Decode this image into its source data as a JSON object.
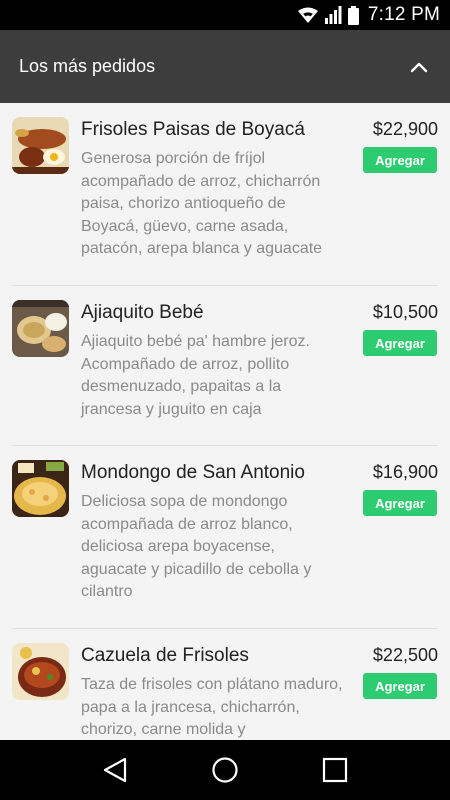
{
  "status_bar": {
    "time": "7:12 PM",
    "icons": [
      "wifi-icon",
      "signal-icon",
      "battery-icon"
    ]
  },
  "header": {
    "title": "Los más pedidos",
    "collapse_icon": "chevron-up-icon"
  },
  "items": [
    {
      "name": "Frisoles Paisas de Boyacá",
      "description": "Generosa porción de fríjol acompañado de arroz, chicharrón paisa, chorizo antioqueño de Boyacá, güevo, carne asada, patacón, arepa blanca y aguacate",
      "price": "$22,900",
      "button": "Agregar"
    },
    {
      "name": "Ajiaquito Bebé",
      "description": "Ajiaquito bebé pa' hambre jeroz. Acompañado de arroz, pollito desmenuzado, papaitas a la jrancesa y juguito en caja",
      "price": "$10,500",
      "button": "Agregar"
    },
    {
      "name": "Mondongo de San Antonio",
      "description": "Deliciosa sopa de mondongo acompañada de arroz blanco, deliciosa arepa boyacense, aguacate y picadillo de cebolla y cilantro",
      "price": "$16,900",
      "button": "Agregar"
    },
    {
      "name": "Cazuela de Frisoles",
      "description": "Taza de frisoles con plátano maduro, papa a la jrancesa, chicharrón, chorizo, carne molida y",
      "price": "$22,500",
      "button": "Agregar"
    }
  ],
  "nav_bar": {
    "icons": [
      "back-icon",
      "home-icon",
      "recents-icon"
    ]
  },
  "colors": {
    "header_bg": "#3d3d3d",
    "accent_button": "#2ecc71",
    "list_bg": "#f4f4f4"
  }
}
